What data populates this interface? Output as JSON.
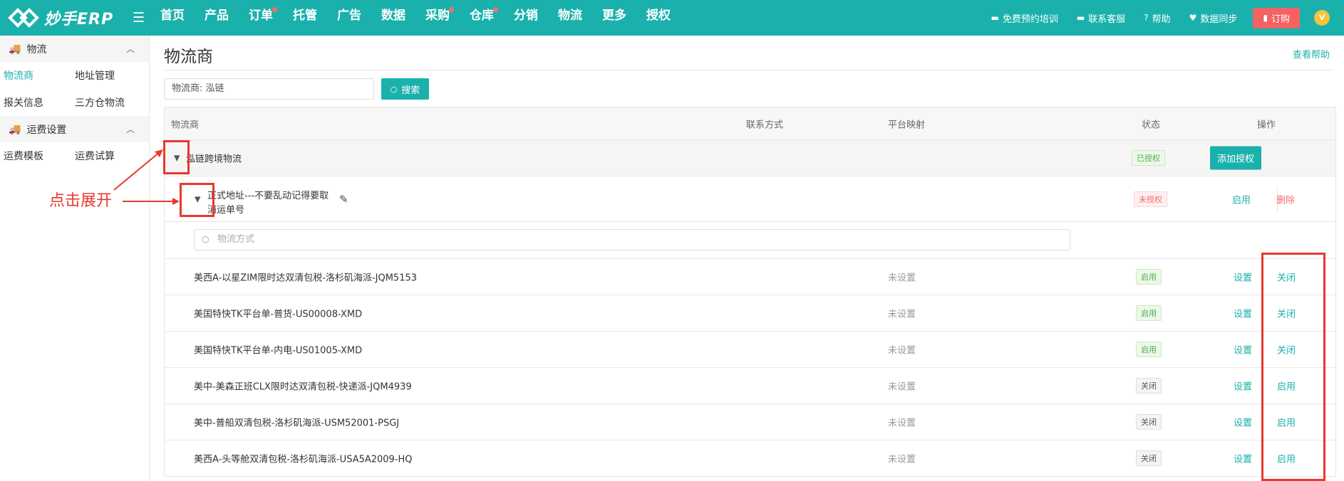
{
  "app": {
    "name": "妙手ERP",
    "menu_icon": "menu-fold-icon"
  },
  "nav": [
    {
      "label": "首页",
      "dot": false
    },
    {
      "label": "产品",
      "dot": false
    },
    {
      "label": "订单",
      "dot": true
    },
    {
      "label": "托管",
      "dot": false
    },
    {
      "label": "广告",
      "dot": false
    },
    {
      "label": "数据",
      "dot": false
    },
    {
      "label": "采购",
      "dot": true
    },
    {
      "label": "仓库",
      "dot": true
    },
    {
      "label": "分销",
      "dot": false
    },
    {
      "label": "物流",
      "dot": false
    },
    {
      "label": "更多",
      "dot": false
    },
    {
      "label": "授权",
      "dot": false
    }
  ],
  "topright": {
    "training": "免费预约培训",
    "service": "联系客服",
    "help": "帮助",
    "sync": "数据同步",
    "buy": "订购",
    "avatar_badge": "V"
  },
  "sidebar": {
    "group1": "物流",
    "g1_items": [
      "物流商",
      "地址管理",
      "报关信息",
      "三方仓物流"
    ],
    "group2": "运费设置",
    "g2_items": [
      "运费模板",
      "运费试算"
    ]
  },
  "main": {
    "title": "物流商",
    "help_link": "查看帮助",
    "search_value": "物流商:  泓链",
    "search_button": "搜索",
    "headers": {
      "provider": "物流商",
      "contact": "联系方式",
      "mapping": "平台映射",
      "status": "状态",
      "action": "操作"
    },
    "provider": {
      "name": "泓链跨境物流",
      "status": "已授权",
      "action": "添加授权"
    },
    "address": {
      "line1": "正式地址---不要乱动记得要取",
      "line2": "消运单号",
      "status": "未授权",
      "enable": "启用",
      "delete": "删除"
    },
    "filter_placeholder": "物流方式",
    "set_label": "设置",
    "items": [
      {
        "name": "美西A-以星ZIM限时达双清包税-洛杉矶海派-JQM5153",
        "mapping": "未设置",
        "status": "启用",
        "toggle": "关闭",
        "on": true
      },
      {
        "name": "美国特快TK平台单-普货-US00008-XMD",
        "mapping": "未设置",
        "status": "启用",
        "toggle": "关闭",
        "on": true
      },
      {
        "name": "美国特快TK平台单-内电-US01005-XMD",
        "mapping": "未设置",
        "status": "启用",
        "toggle": "关闭",
        "on": true
      },
      {
        "name": "美中-美森正班CLX限时达双清包税-快递派-JQM4939",
        "mapping": "未设置",
        "status": "关闭",
        "toggle": "启用",
        "on": false
      },
      {
        "name": "美中-普船双清包税-洛杉矶海派-USM52001-PSGJ",
        "mapping": "未设置",
        "status": "关闭",
        "toggle": "启用",
        "on": false
      },
      {
        "name": "美西A-头等舱双清包税-洛杉矶海派-USA5A2009-HQ",
        "mapping": "未设置",
        "status": "关闭",
        "toggle": "启用",
        "on": false
      }
    ]
  },
  "annotation": {
    "text": "点击展开",
    "color": "#e8382f"
  }
}
